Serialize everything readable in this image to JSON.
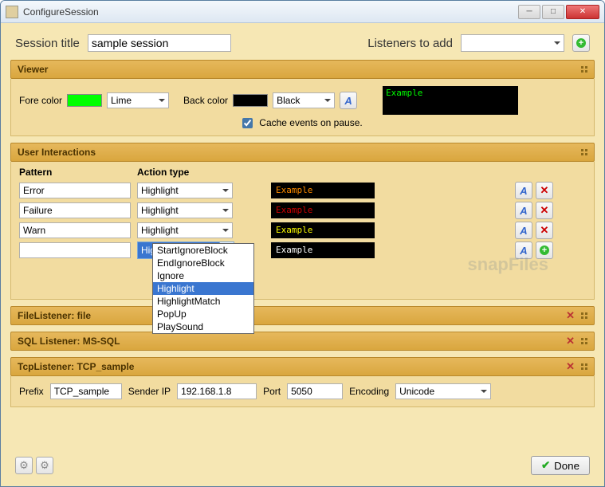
{
  "window": {
    "title": "ConfigureSession"
  },
  "top": {
    "session_title_label": "Session title",
    "session_title_value": "sample session",
    "listeners_label": "Listeners to add",
    "listeners_value": ""
  },
  "viewer": {
    "header": "Viewer",
    "fore_label": "Fore color",
    "fore_swatch": "#00FF00",
    "fore_value": "Lime",
    "back_label": "Back color",
    "back_swatch": "#000000",
    "back_value": "Black",
    "cache_label": "Cache events on pause.",
    "cache_checked": true,
    "preview_text": "Example",
    "preview_fg": "#00FF00",
    "preview_bg": "#000000"
  },
  "interactions": {
    "header": "User Interactions",
    "col_pattern": "Pattern",
    "col_action": "Action type",
    "rows": [
      {
        "pattern": "Error",
        "action": "Highlight",
        "example": "Example",
        "example_color": "#FF8C00"
      },
      {
        "pattern": "Failure",
        "action": "Highlight",
        "example": "Example",
        "example_color": "#CC0000"
      },
      {
        "pattern": "Warn",
        "action": "Highlight",
        "example": "Example",
        "example_color": "#FFFF00"
      }
    ],
    "new_row": {
      "pattern": "",
      "action_selected": "Highlight",
      "example": "Example",
      "example_color": "#FFFFFF"
    },
    "dropdown_options": [
      "StartIgnoreBlock",
      "EndIgnoreBlock",
      "Ignore",
      "Highlight",
      "HighlightMatch",
      "PopUp",
      "PlaySound"
    ],
    "dropdown_selected": "Highlight"
  },
  "file_listener": {
    "header": "FileListener: file"
  },
  "sql_listener": {
    "header": "SQL Listener: MS-SQL"
  },
  "tcp_listener": {
    "header": "TcpListener: TCP_sample",
    "prefix_label": "Prefix",
    "prefix_value": "TCP_sample",
    "sender_label": "Sender IP",
    "sender_value": "192.168.1.8",
    "port_label": "Port",
    "port_value": "5050",
    "encoding_label": "Encoding",
    "encoding_value": "Unicode"
  },
  "footer": {
    "done_label": "Done"
  },
  "watermark": "snapFiles"
}
